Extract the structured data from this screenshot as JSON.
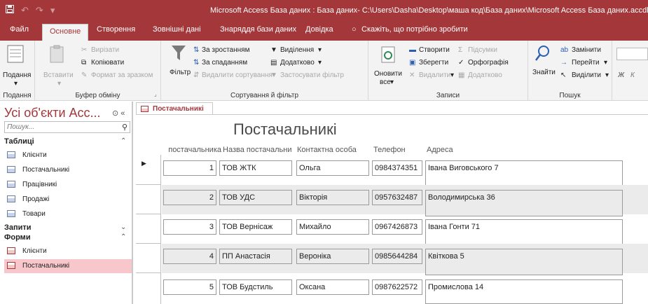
{
  "titlebar": {
    "title": "Microsoft Access База даних : База даних- C:\\Users\\Dasha\\Desktop\\маша код\\База даних\\Microsoft Access База даних.accdb (Ф",
    "save_icon": "save-icon",
    "undo_icon": "undo-icon",
    "redo_icon": "redo-icon"
  },
  "menu": {
    "tabs": [
      "Файл",
      "Основне",
      "Створення",
      "Зовнішні дані",
      "Знаряддя бази даних",
      "Довідка"
    ],
    "tellme": "Скажіть, що потрібно зробити"
  },
  "ribbon": {
    "views": {
      "button": "Подання",
      "group": "Подання"
    },
    "clipboard": {
      "paste": "Вставити",
      "cut": "Вирізати",
      "copy": "Копіювати",
      "format_painter": "Формат за зразком",
      "group": "Буфер обміну"
    },
    "sort_filter": {
      "filter": "Фільтр",
      "ascending": "За зростанням",
      "descending": "За спаданням",
      "remove_sort": "Видалити сортування",
      "selection": "Виділення",
      "advanced": "Додатково",
      "toggle_filter": "Застосувати фільтр",
      "group": "Сортування й фільтр"
    },
    "records": {
      "refresh": "Оновити",
      "refresh2": "все",
      "new": "Створити",
      "save": "Зберегти",
      "delete": "Видалити",
      "totals": "Підсумки",
      "spelling": "Орфографія",
      "more": "Додатково",
      "group": "Записи"
    },
    "find": {
      "find": "Знайти",
      "replace": "Замінити",
      "goto": "Перейти",
      "select": "Виділити",
      "group": "Пошук"
    },
    "font_bold": "Ж",
    "font_italic": "К"
  },
  "nav": {
    "title": "Усі об'єкти Acc...",
    "search_placeholder": "Пошук...",
    "sections": {
      "tables": {
        "label": "Таблиці",
        "items": [
          "Клієнти",
          "Постачальникі",
          "Працівникі",
          "Продажі",
          "Товари"
        ]
      },
      "queries": {
        "label": "Запити"
      },
      "forms": {
        "label": "Форми",
        "items": [
          "Клієнти",
          "Постачальникі"
        ]
      }
    }
  },
  "document": {
    "tab_label": "Постачальникі",
    "form_title": "Постачальникі",
    "columns": [
      "постачальника",
      "Назва постачальни",
      "Контактна особа",
      "Телефон",
      "Адреса"
    ],
    "rows": [
      {
        "id": "1",
        "name": "ТОВ ЖТК",
        "contact": "Ольга",
        "phone": "0984374351",
        "address": "Івана Виговського 7"
      },
      {
        "id": "2",
        "name": "ТОВ УДС",
        "contact": "Вікторія",
        "phone": "0957632487",
        "address": "Володимирська 36"
      },
      {
        "id": "3",
        "name": "ТОВ Вернісаж",
        "contact": "Михайло",
        "phone": "0967426873",
        "address": "Івана Гонти 71"
      },
      {
        "id": "4",
        "name": "ПП Анастасія",
        "contact": "Вероніка",
        "phone": "0985644284",
        "address": "Квіткова 5"
      },
      {
        "id": "5",
        "name": "ТОВ Будстиль",
        "contact": "Оксана",
        "phone": "0987622572",
        "address": "Промислова 14"
      }
    ]
  },
  "colors": {
    "accent": "#a4373a",
    "selection": "#f8c7cc",
    "ribbon_bg": "#f3f3f3",
    "alt_row": "#ebebeb"
  }
}
